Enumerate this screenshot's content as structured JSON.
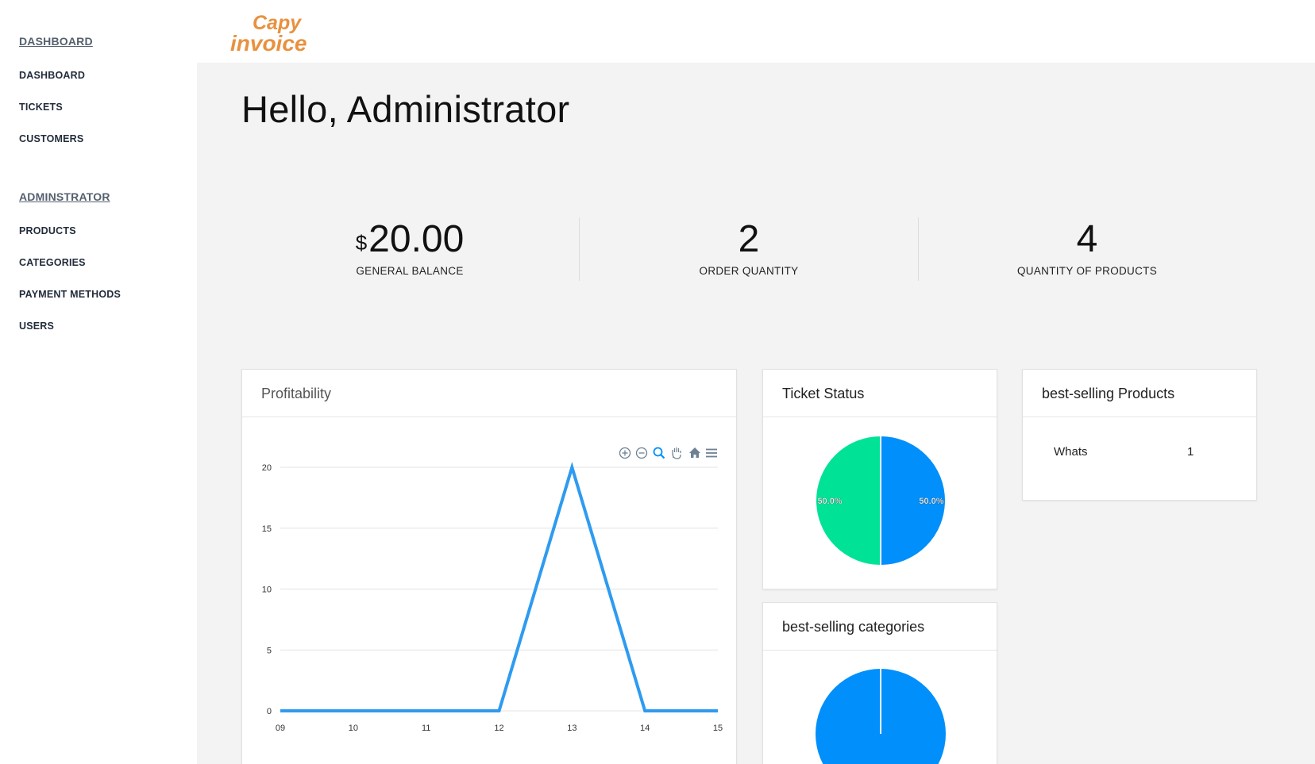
{
  "sidebar": {
    "sections": [
      {
        "title": "DASHBOARD",
        "items": [
          "DASHBOARD",
          "TICKETS",
          "CUSTOMERS"
        ]
      },
      {
        "title": "ADMINSTRATOR",
        "items": [
          "PRODUCTS",
          "CATEGORIES",
          "PAYMENT METHODS",
          "USERS"
        ]
      }
    ]
  },
  "logo": {
    "line1": "Capy",
    "line2": "invoice",
    "color": "#e8913f"
  },
  "greeting": "Hello, Administrator",
  "stats": [
    {
      "currency": "$",
      "value": "20.00",
      "label": "GENERAL BALANCE"
    },
    {
      "value": "2",
      "label": "ORDER QUANTITY"
    },
    {
      "value": "4",
      "label": "QUANTITY OF PRODUCTS"
    }
  ],
  "cards": {
    "profitability": "Profitability",
    "ticket_status": "Ticket Status",
    "best_products": "best-selling Products",
    "best_categories": "best-selling categories"
  },
  "best_products": [
    {
      "name": "Whats",
      "qty": "1"
    }
  ],
  "chart_toolbar": [
    "zoom-in-icon",
    "zoom-out-icon",
    "selection-zoom-icon",
    "pan-icon",
    "home-icon",
    "menu-icon"
  ],
  "colors": {
    "blue": "#008ffb",
    "green": "#00e396",
    "line": "#2e9bf0"
  },
  "chart_data": [
    {
      "type": "line",
      "title": "Profitability",
      "categories": [
        "09",
        "10",
        "11",
        "12",
        "13",
        "14",
        "15"
      ],
      "series": [
        {
          "values": [
            0,
            0,
            0,
            0,
            20,
            0,
            0
          ]
        }
      ],
      "ylim": [
        0,
        20
      ],
      "yticks": [
        0,
        5,
        10,
        15,
        20
      ],
      "grid": true
    },
    {
      "type": "pie",
      "title": "Ticket Status",
      "values": [
        50.0,
        50.0
      ],
      "labels": [
        "50.0%",
        "50.0%"
      ],
      "colors": [
        "#008ffb",
        "#00e396"
      ]
    },
    {
      "type": "pie",
      "title": "best-selling categories",
      "values": [
        100
      ],
      "colors": [
        "#008ffb"
      ]
    }
  ]
}
